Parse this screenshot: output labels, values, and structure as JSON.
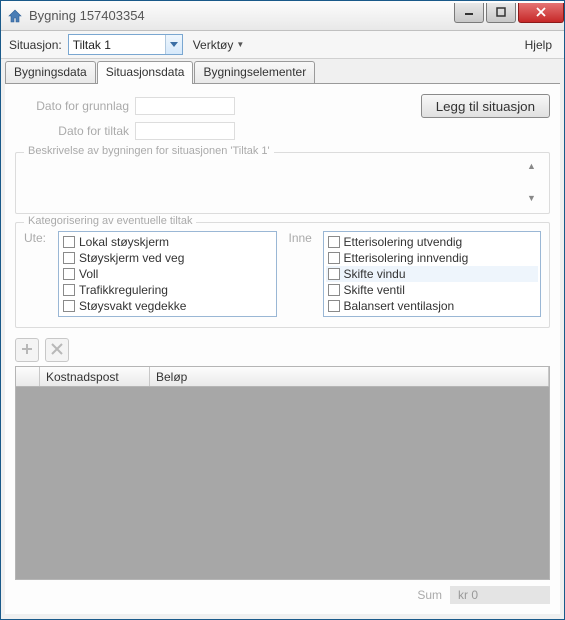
{
  "window": {
    "title": "Bygning 157403354"
  },
  "toolbar": {
    "situasjon_label": "Situasjon:",
    "situasjon_value": "Tiltak 1",
    "verktoy_label": "Verktøy",
    "help_label": "Hjelp"
  },
  "tabs": {
    "bygningsdata": "Bygningsdata",
    "situasjonsdata": "Situasjonsdata",
    "bygningselementer": "Bygningselementer",
    "active": "situasjonsdata"
  },
  "dates": {
    "grunnlag_label": "Dato for grunnlag",
    "grunnlag_value": "",
    "tiltak_label": "Dato for tiltak",
    "tiltak_value": ""
  },
  "legg_til_label": "Legg til situasjon",
  "beskrivelse": {
    "legend": "Beskrivelse av bygningen for situasjonen 'Tiltak 1'",
    "text": ""
  },
  "kategorisering": {
    "legend": "Kategorisering av eventuelle tiltak",
    "ute_label": "Ute:",
    "inne_label": "Inne",
    "ute": [
      {
        "label": "Lokal støyskjerm",
        "checked": false
      },
      {
        "label": "Støyskjerm ved veg",
        "checked": false
      },
      {
        "label": "Voll",
        "checked": false
      },
      {
        "label": "Trafikkregulering",
        "checked": false
      },
      {
        "label": "Støysvakt vegdekke",
        "checked": false
      }
    ],
    "inne": [
      {
        "label": "Etterisolering utvendig",
        "checked": false
      },
      {
        "label": "Etterisolering innvendig",
        "checked": false
      },
      {
        "label": "Skifte vindu",
        "checked": false,
        "selected": true
      },
      {
        "label": "Skifte ventil",
        "checked": false
      },
      {
        "label": "Balansert ventilasjon",
        "checked": false
      }
    ]
  },
  "grid": {
    "columns": {
      "kostnadspost": "Kostnadspost",
      "belop": "Beløp"
    },
    "rows": []
  },
  "sum": {
    "label": "Sum",
    "value": "kr 0"
  }
}
